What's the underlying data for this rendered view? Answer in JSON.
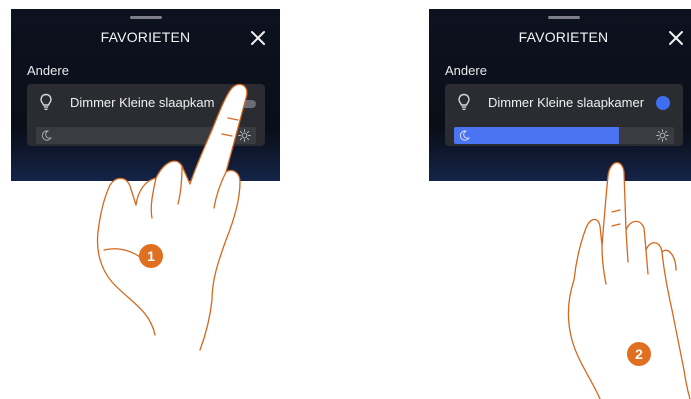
{
  "screens": [
    {
      "title": "FAVORIETEN",
      "section": "Andere",
      "device_label": "Dimmer Kleine slaapkam",
      "toggle_on": false,
      "brightness_percent": 0
    },
    {
      "title": "FAVORIETEN",
      "section": "Andere",
      "device_label": "Dimmer Kleine slaapkamer",
      "toggle_on": true,
      "brightness_percent": 75
    }
  ],
  "steps": [
    "1",
    "2"
  ],
  "icons": {
    "close": "close-icon",
    "bulb": "lightbulb-icon",
    "moon": "moon-icon",
    "sun": "sun-icon"
  },
  "colors": {
    "accent": "#4b74f2",
    "step_badge": "#e0701f",
    "hand_outline": "#d5681f"
  }
}
